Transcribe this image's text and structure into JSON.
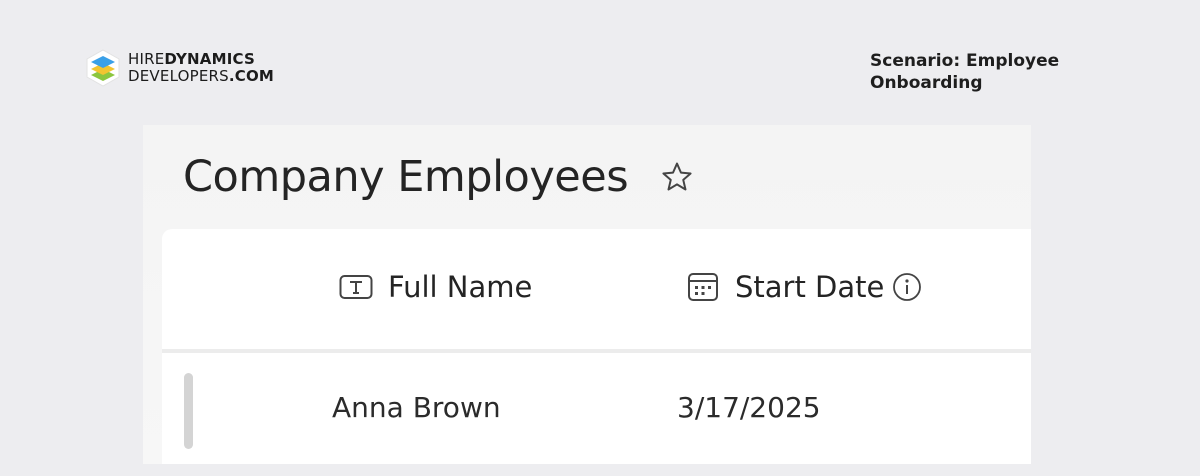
{
  "brand": {
    "line1_light": "HIRE",
    "line1_bold": "DYNAMICS",
    "line2_light": "DEVELOPERS",
    "line2_bold": ".COM",
    "colors": [
      "#3aa0e8",
      "#f2c531",
      "#8cc63f"
    ]
  },
  "scenario": {
    "text": "Scenario: Employee Onboarding"
  },
  "page": {
    "title": "Company Employees",
    "favorite_icon": "star-outline-icon"
  },
  "grid": {
    "columns": [
      {
        "label": "Full Name",
        "icon": "text-field-icon"
      },
      {
        "label": "Start Date",
        "icon": "calendar-icon",
        "info_icon": "info-icon"
      }
    ],
    "rows": [
      {
        "full_name": "Anna Brown",
        "start_date": "3/17/2025"
      }
    ]
  }
}
